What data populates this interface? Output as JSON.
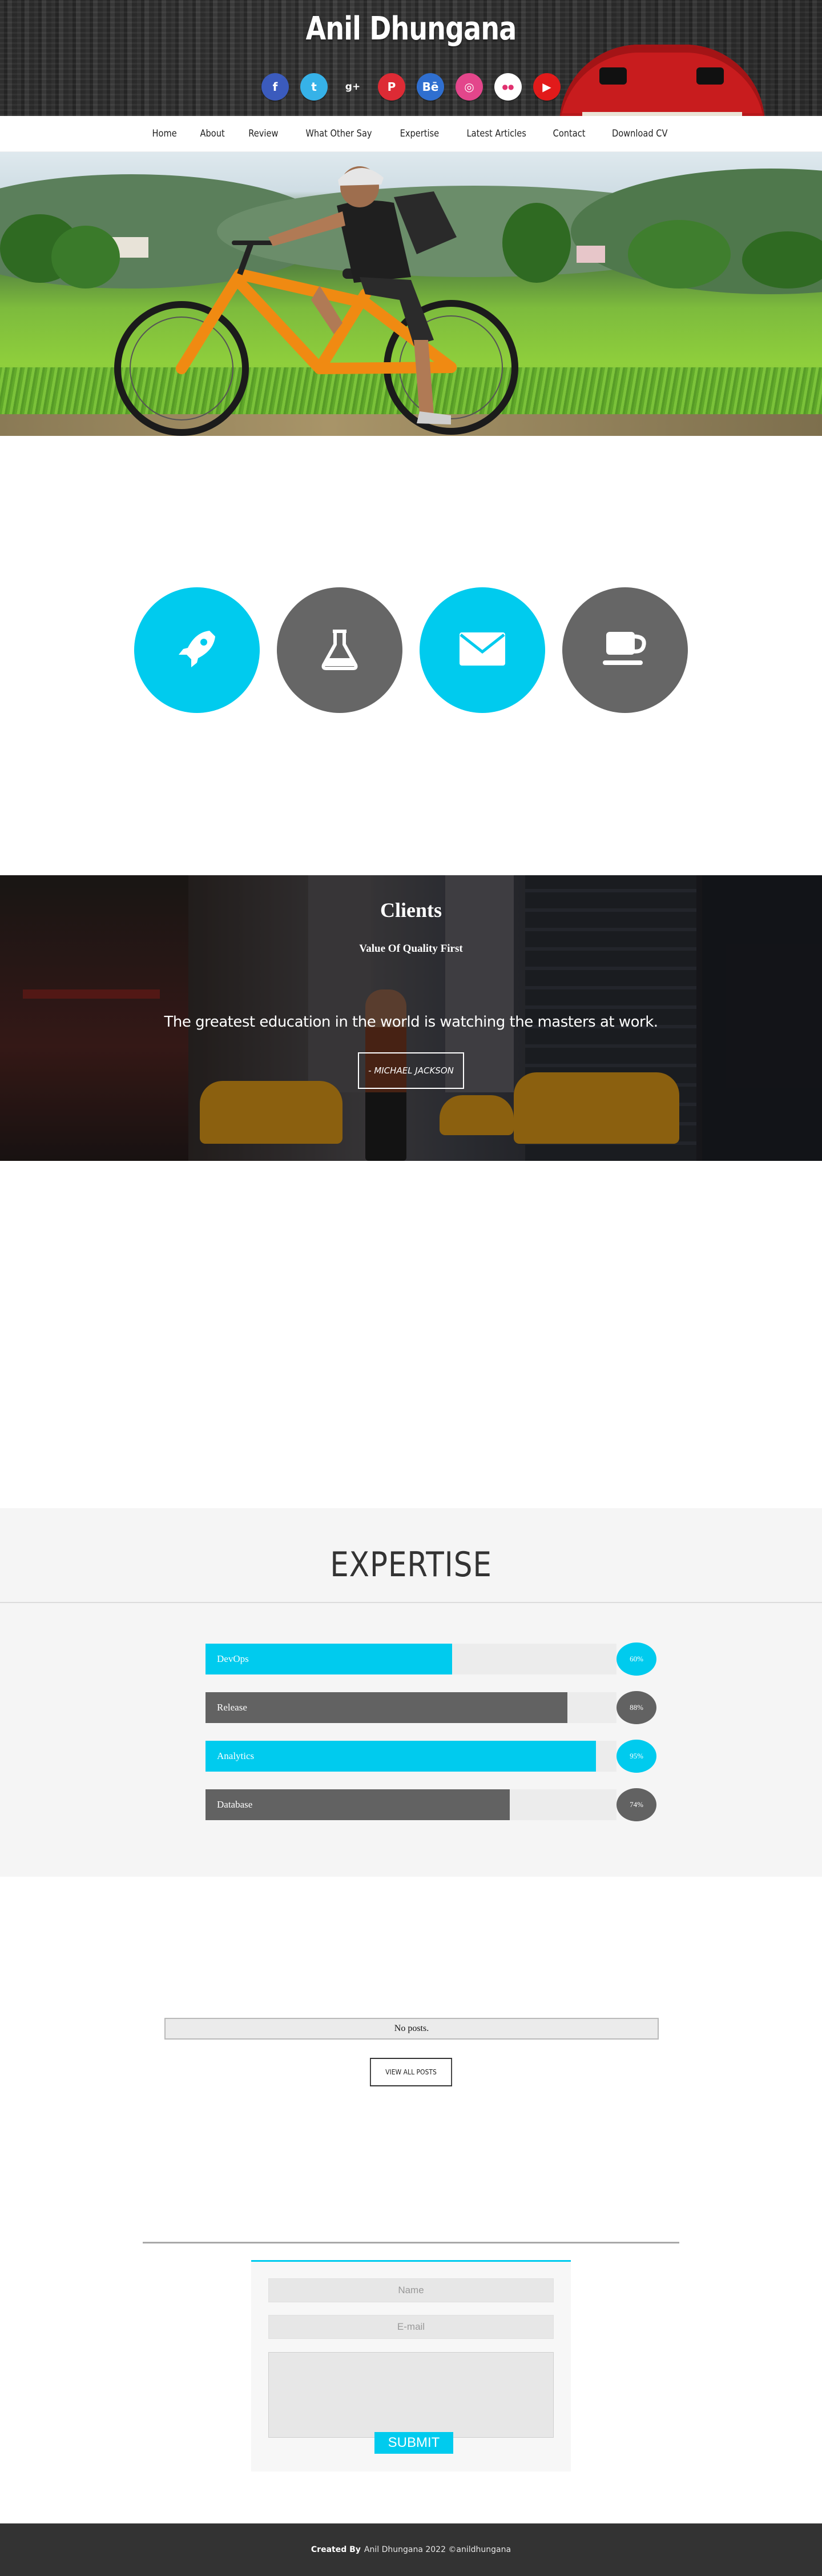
{
  "site": {
    "title": "Anil Dhungana"
  },
  "social": [
    {
      "name": "facebook-icon",
      "glyph": "f",
      "color": "#3b5bbd"
    },
    {
      "name": "twitter-icon",
      "glyph": "t",
      "color": "#36b2e8"
    },
    {
      "name": "google-plus-icon",
      "glyph": "g+",
      "color": "#3a3a3a"
    },
    {
      "name": "pinterest-icon",
      "glyph": "P",
      "color": "#dd2b35"
    },
    {
      "name": "behance-icon",
      "glyph": "Bē",
      "color": "#2f6fd0"
    },
    {
      "name": "dribbble-icon",
      "glyph": "◎",
      "color": "#e3468b"
    },
    {
      "name": "flickr-icon",
      "glyph": "●●",
      "color": "#ffffff"
    },
    {
      "name": "youtube-icon",
      "glyph": "▶",
      "color": "#e21a1a"
    }
  ],
  "nav": [
    "Home",
    "About",
    "Review",
    "What Other Say",
    "Expertise",
    "Latest Articles",
    "Contact",
    "Download CV"
  ],
  "features": [
    {
      "icon": "rocket-icon",
      "style": "blue"
    },
    {
      "icon": "flask-icon",
      "style": "gray"
    },
    {
      "icon": "envelope-icon",
      "style": "blue"
    },
    {
      "icon": "coffee-icon",
      "style": "gray"
    }
  ],
  "clients": {
    "title": "Clients",
    "subtitle": "Value Of Quality First",
    "quote": "The greatest education in the world is watching the masters at work.",
    "author": "- MICHAEL JACKSON"
  },
  "expertise": {
    "title": "EXPERTISE",
    "skills": [
      {
        "label": "DevOps",
        "percent_label": "60%",
        "value": 60,
        "style": "blue"
      },
      {
        "label": "Release",
        "percent_label": "88%",
        "value": 88,
        "style": "gray"
      },
      {
        "label": "Analytics",
        "percent_label": "95%",
        "value": 95,
        "style": "blue"
      },
      {
        "label": "Database",
        "percent_label": "74%",
        "value": 74,
        "style": "gray"
      }
    ]
  },
  "posts": {
    "empty_text": "No posts.",
    "view_all": "VIEW ALL POSTS"
  },
  "contact": {
    "name_placeholder": "Name",
    "email_placeholder": "E-mail",
    "submit": "SUBMIT"
  },
  "footer": {
    "created_by": "Created By",
    "credit": "Anil Dhungana 2022 ©anildhungana"
  },
  "colors": {
    "accent": "#00cbee",
    "dark": "#666666",
    "footer": "#333333"
  }
}
